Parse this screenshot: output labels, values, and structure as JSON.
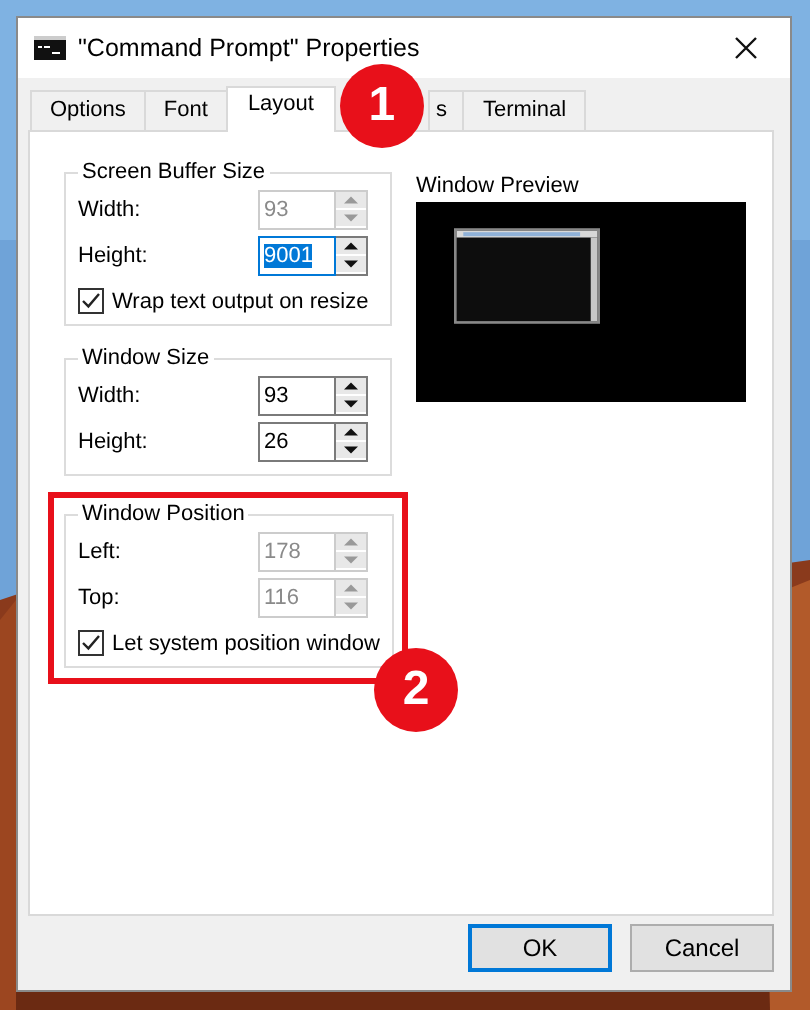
{
  "window": {
    "title": "\"Command Prompt\" Properties"
  },
  "tabs": [
    {
      "label": "Options",
      "selected": false
    },
    {
      "label": "Font",
      "selected": false
    },
    {
      "label": "Layout",
      "selected": true
    },
    {
      "label": "s",
      "selected": false
    },
    {
      "label": "Terminal",
      "selected": false
    }
  ],
  "groups": [
    {
      "title": "Screen Buffer Size",
      "highlighted": false,
      "fields": [
        {
          "label": "Width:",
          "value": "93",
          "disabled": true,
          "focused": false
        },
        {
          "label": "Height:",
          "value": "9001",
          "disabled": false,
          "focused": true
        }
      ],
      "checkbox": {
        "label": "Wrap text output on resize",
        "checked": true
      }
    },
    {
      "title": "Window Size",
      "highlighted": false,
      "fields": [
        {
          "label": "Width:",
          "value": "93",
          "disabled": false,
          "focused": false
        },
        {
          "label": "Height:",
          "value": "26",
          "disabled": false,
          "focused": false
        }
      ]
    },
    {
      "title": "Window Position",
      "highlighted": true,
      "fields": [
        {
          "label": "Left:",
          "value": "178",
          "disabled": true,
          "focused": false
        },
        {
          "label": "Top:",
          "value": "116",
          "disabled": true,
          "focused": false
        }
      ],
      "checkbox": {
        "label": "Let system position window",
        "checked": true
      }
    }
  ],
  "preview": {
    "title": "Window Preview"
  },
  "buttons": [
    {
      "label": "OK",
      "default": true
    },
    {
      "label": "Cancel",
      "default": false
    }
  ],
  "callouts": [
    {
      "number": "1"
    },
    {
      "number": "2"
    }
  ]
}
